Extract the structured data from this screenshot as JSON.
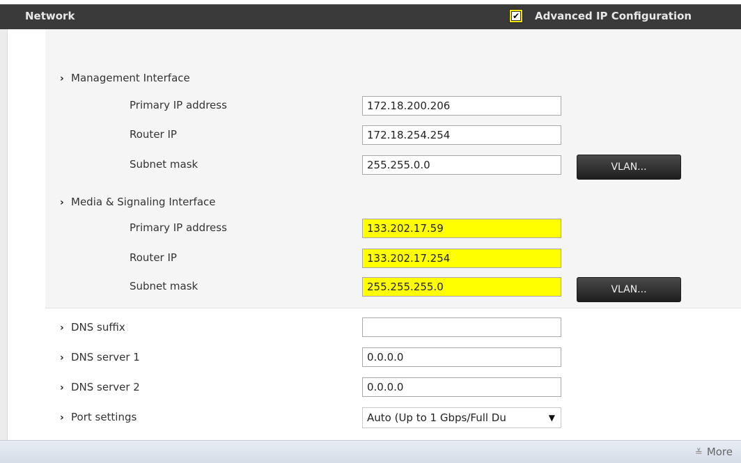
{
  "header": {
    "title": "Network",
    "advanced_checked": true,
    "advanced_label": "Advanced IP Configuration",
    "check_glyph": "✔"
  },
  "management": {
    "title": "Management Interface",
    "primary_ip_label": "Primary IP address",
    "primary_ip_value": "172.18.200.206",
    "router_ip_label": "Router IP",
    "router_ip_value": "172.18.254.254",
    "subnet_label": "Subnet mask",
    "subnet_value": "255.255.0.0",
    "vlan_label": "VLAN..."
  },
  "media": {
    "title": "Media & Signaling Interface",
    "primary_ip_label": "Primary IP address",
    "primary_ip_value": "133.202.17.59",
    "router_ip_label": "Router IP",
    "router_ip_value": "133.202.17.254",
    "subnet_label": "Subnet mask",
    "subnet_value": "255.255.255.0",
    "vlan_label": "VLAN...",
    "highlight_color": "#ffff00"
  },
  "dns": {
    "suffix_label": "DNS suffix",
    "suffix_value": "",
    "server1_label": "DNS server 1",
    "server1_value": "0.0.0.0",
    "server2_label": "DNS server 2",
    "server2_value": "0.0.0.0"
  },
  "port": {
    "label": "Port settings",
    "selected": "Auto (Up to 1 Gbps/Full Du"
  },
  "footer": {
    "more_label": "More",
    "more_icon": "chevron-double-down-icon"
  },
  "icons": {
    "chevron": "chevron-right-icon"
  }
}
